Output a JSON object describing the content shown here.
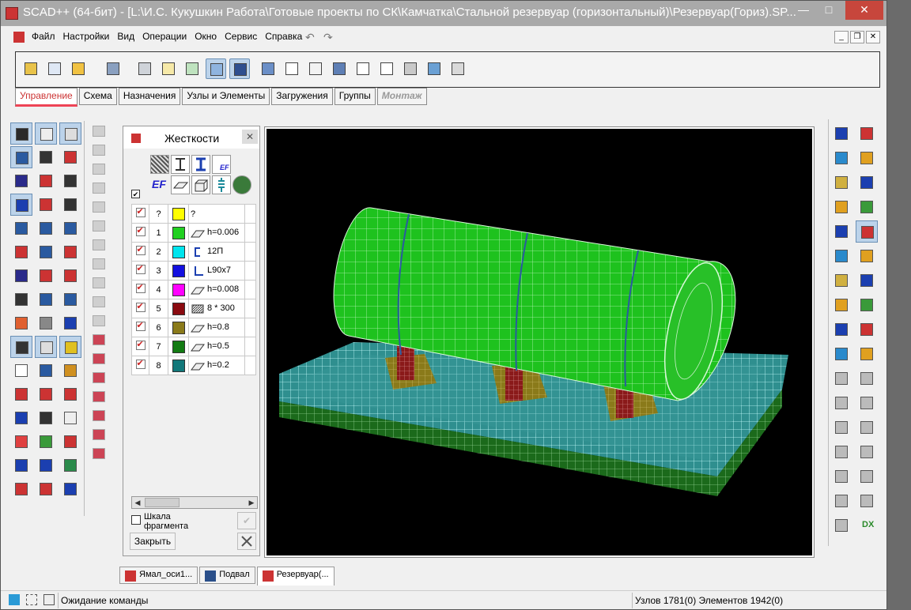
{
  "window": {
    "title": "SCAD++ (64-бит) - [L:\\И.С. Кукушкин Работа\\Готовые проекты по СК\\Камчатка\\Стальной резервуар (горизонтальный)\\Резервуар(Гориз).SP...",
    "min": "—",
    "max": "□",
    "close": "✕"
  },
  "menu": {
    "items": [
      "Файл",
      "Настройки",
      "Вид",
      "Операции",
      "Окно",
      "Сервис",
      "Справка"
    ],
    "undo": "↶",
    "redo": "↷",
    "mdi_min": "_",
    "mdi_restore": "❐",
    "mdi_close": "✕"
  },
  "tabs": [
    {
      "label": "Управление",
      "active": true
    },
    {
      "label": "Схема"
    },
    {
      "label": "Назначения"
    },
    {
      "label": "Узлы и Элементы"
    },
    {
      "label": "Загружения"
    },
    {
      "label": "Группы"
    },
    {
      "label": "Монтаж",
      "disabled": true
    }
  ],
  "panel": {
    "title": "Жесткости",
    "close": "✕",
    "ef_label": "EF",
    "rows": [
      {
        "check": true,
        "num": "?",
        "color": "#ffff00",
        "section": "?",
        "icon": "none"
      },
      {
        "check": true,
        "num": "1",
        "color": "#21d021",
        "section": "h=0.006",
        "icon": "plate"
      },
      {
        "check": true,
        "num": "2",
        "color": "#00e5ee",
        "section": "12П",
        "icon": "channel"
      },
      {
        "check": true,
        "num": "3",
        "color": "#1410e0",
        "section": "L90x7",
        "icon": "angle"
      },
      {
        "check": true,
        "num": "4",
        "color": "#ff00ff",
        "section": "h=0.008",
        "icon": "plate"
      },
      {
        "check": true,
        "num": "5",
        "color": "#8a0a10",
        "section": "8 * 300",
        "icon": "rect"
      },
      {
        "check": true,
        "num": "6",
        "color": "#8a7a1a",
        "section": "h=0.8",
        "icon": "plate"
      },
      {
        "check": true,
        "num": "7",
        "color": "#127a12",
        "section": "h=0.5",
        "icon": "plate"
      },
      {
        "check": true,
        "num": "8",
        "color": "#12787a",
        "section": "h=0.2",
        "icon": "plate"
      }
    ],
    "scale_label": "Шкала фрагмента",
    "close_button": "Закрыть",
    "apply": "✔"
  },
  "doc_tabs": [
    {
      "label": "Ямал_оси1..."
    },
    {
      "label": "Подвал"
    },
    {
      "label": "Резервуар(...",
      "active": true
    }
  ],
  "status": {
    "message": "Ожидание команды",
    "counts": "Узлов 1781(0) Элементов 1942(0)"
  },
  "right_dx": "DX",
  "colors": {
    "accent": "#cc3333",
    "viewport_bg": "#000000",
    "tank_green": "#22cc22",
    "base_cyan": "#3aa7a0"
  }
}
